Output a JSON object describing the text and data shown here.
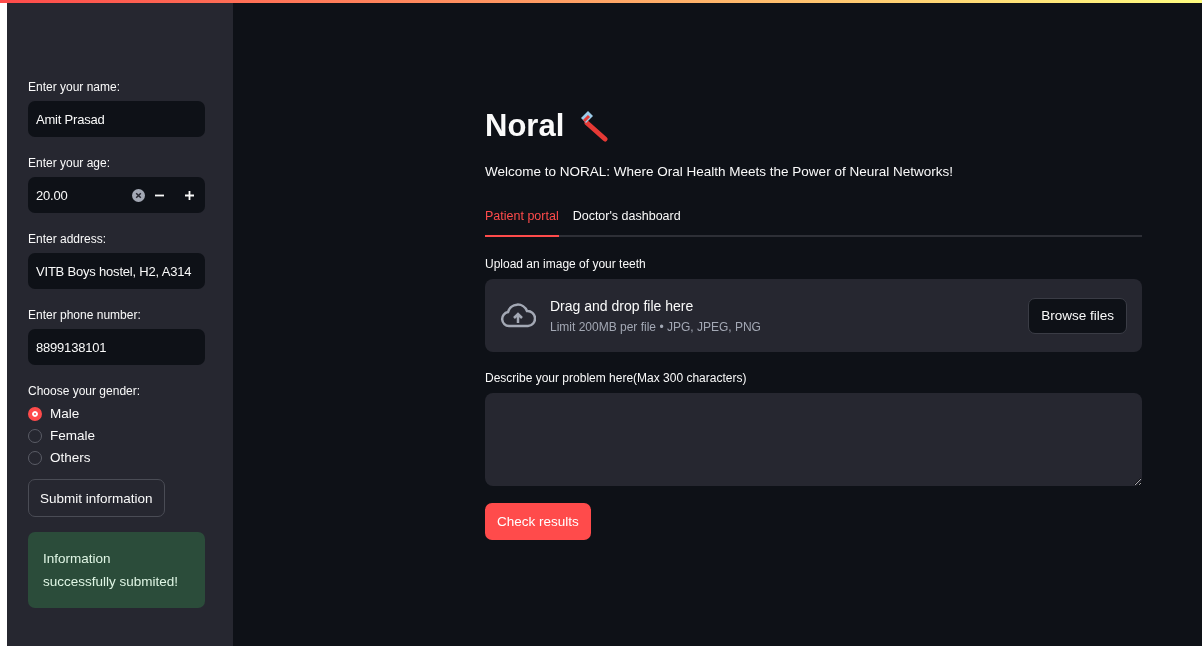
{
  "sidebar": {
    "fields": [
      {
        "kind": "text",
        "label": "Enter your name:",
        "value": "Amit Prasad"
      },
      {
        "kind": "number",
        "label": "Enter your age:",
        "value": "20.00"
      },
      {
        "kind": "text",
        "label": "Enter address:",
        "value": "VITB Boys hostel, H2, A314"
      },
      {
        "kind": "text",
        "label": "Enter phone number:",
        "value": "8899138101"
      }
    ],
    "gender": {
      "label": "Choose your gender:",
      "options": [
        {
          "label": "Male",
          "selected": true
        },
        {
          "label": "Female",
          "selected": false
        },
        {
          "label": "Others",
          "selected": false
        }
      ]
    },
    "submit_button": "Submit information",
    "success_message": "Information successfully submited!"
  },
  "main": {
    "title": "Noral",
    "subtitle": "Welcome to NORAL: Where Oral Health Meets the Power of Neural Networks!",
    "tabs": [
      {
        "label": "Patient portal",
        "selected": true
      },
      {
        "label": "Doctor's dashboard",
        "selected": false
      }
    ],
    "upload": {
      "label": "Upload an image of your teeth",
      "dropzone_title": "Drag and drop file here",
      "dropzone_hint": "Limit 200MB per file • JPG, JPEG, PNG",
      "browse_button": "Browse files"
    },
    "problem": {
      "label": "Describe your problem here(Max 300 characters)"
    },
    "check_button": "Check results"
  }
}
